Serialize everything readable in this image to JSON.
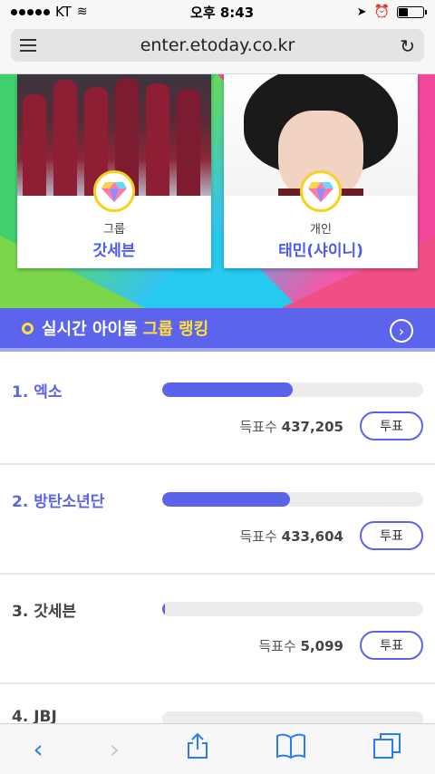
{
  "status": {
    "carrier": "KT",
    "time": "오후 8:43"
  },
  "browser": {
    "url": "enter.etoday.co.kr"
  },
  "featured": [
    {
      "category": "그룹",
      "name": "갓세븐"
    },
    {
      "category": "개인",
      "name": "태민(샤이니)"
    }
  ],
  "ranking_banner": {
    "title_white": "실시간 아이돌",
    "title_yellow": "그룹 랭킹"
  },
  "ranking": [
    {
      "name": "1. 엑소",
      "votes_label": "득표수",
      "votes": "437,205",
      "fill": 0.5,
      "button": "투표"
    },
    {
      "name": "2. 방탄소년단",
      "votes_label": "득표수",
      "votes": "433,604",
      "fill": 0.49,
      "button": "투표"
    },
    {
      "name": "3. 갓세븐",
      "votes_label": "득표수",
      "votes": "5,099",
      "fill": 0.006,
      "button": "투표"
    },
    {
      "name": "4. JBJ"
    }
  ],
  "colors": {
    "accent": "#5b62ec",
    "highlight": "#ffe03b"
  }
}
